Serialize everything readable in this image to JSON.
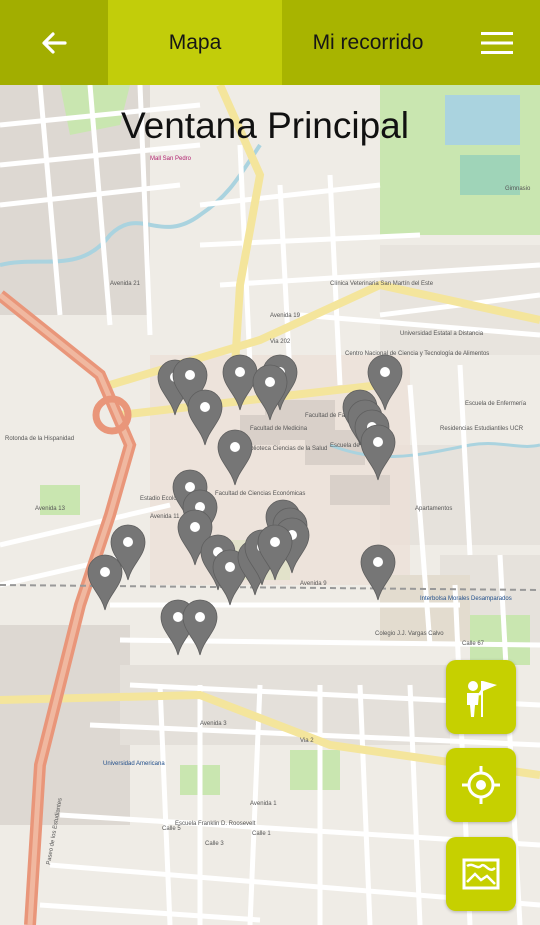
{
  "header": {
    "back_icon": "arrow-left-icon",
    "tabs": [
      {
        "label": "Mapa",
        "active": true
      },
      {
        "label": "Mi recorrido",
        "active": false
      }
    ],
    "menu_icon": "hamburger-menu-icon"
  },
  "map": {
    "title": "Ventana Principal",
    "labels": {
      "avenida_21": "Avenida 21",
      "avenida_19": "Avenida 19",
      "avenida_13": "Avenida 13",
      "avenida_11": "Avenida 11",
      "avenida_9": "Avenida 9",
      "avenida_3": "Avenida 3",
      "avenida_1": "Avenida 1",
      "via_2": "Via 2",
      "via_202": "Via 202",
      "calle_1": "Calle 1",
      "calle_3": "Calle 3",
      "calle_5": "Calle 5",
      "calle_67": "Calle 67",
      "facultad_farmacia": "Facultad de Farmacia",
      "facultad_medicina": "Facultad de Medicina",
      "escuela_biologia": "Escuela de Biología",
      "facultad_ciencias_economicas": "Facultad de Ciencias Económicas",
      "biblioteca_salud": "Biblioteca Ciencias de la Salud",
      "universidad_distancia": "Universidad Estatal a Distancia",
      "colegio_vargas": "Colegio J.J. Vargas Calvo",
      "gimnasio": "Gimnasio",
      "mall": "Mall San Pedro",
      "clinica": "Clínica Veterinaria San Martín del Este",
      "centro_nacional": "Centro Nacional de Ciencia y Tecnología de Alimentos",
      "escuela_enfermeria": "Escuela de Enfermería",
      "residencias": "Residencias Estudiantiles UCR",
      "estadio": "Estadio Ecológico",
      "apartamentos": "Apartamentos",
      "universidad_americana": "Universidad Americana",
      "escuela_roosevelt": "Escuela Franklin D. Roosevelt",
      "rotonda": "Rotonda de la Hispanidad",
      "interbolsa": "Interbolsa Morales Desamparados",
      "paseo_estudiantes": "Paseo de los Estudiantes"
    },
    "markers_count": 28
  },
  "fab_buttons": [
    {
      "name": "guide-route-button",
      "icon": "tour-guide-flag-icon"
    },
    {
      "name": "my-location-button",
      "icon": "target-location-icon"
    },
    {
      "name": "map-view-button",
      "icon": "map-icon"
    }
  ],
  "colors": {
    "header_bg": "#a8b400",
    "active_tab": "#c2cd0a",
    "fab_bg": "#c6d000",
    "marker": "#767676",
    "main_road": "#e9967a",
    "secondary_road": "#f5e7a0",
    "park": "#cde8b5"
  }
}
